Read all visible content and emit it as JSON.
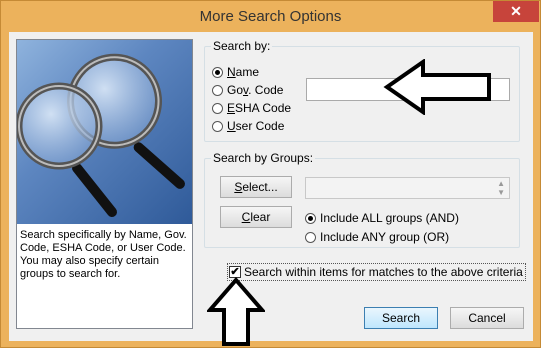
{
  "window": {
    "title": "More Search Options",
    "close": "✕"
  },
  "side": {
    "description": "Search specifically by Name, Gov. Code, ESHA Code, or User Code. You may also specify certain groups to search for."
  },
  "search_by": {
    "legend": "Search by:",
    "options": [
      {
        "pre": "",
        "ul": "N",
        "post": "ame",
        "checked": true
      },
      {
        "pre": "Go",
        "ul": "v",
        "post": ". Code",
        "checked": false
      },
      {
        "pre": "",
        "ul": "E",
        "post": "SHA Code",
        "checked": false
      },
      {
        "pre": "",
        "ul": "U",
        "post": "ser Code",
        "checked": false
      }
    ],
    "query_value": ""
  },
  "groups": {
    "legend": "Search by Groups:",
    "select_button": {
      "ul": "S",
      "post": "elect..."
    },
    "clear_button": {
      "pre": "",
      "ul": "C",
      "post": "lear"
    },
    "selected_value": "",
    "include_all": "Include ALL groups (AND)",
    "include_any": "Include ANY group (OR)",
    "include_all_checked": true
  },
  "within_items": {
    "label": "Search within items for matches to the above criteria",
    "checked": true,
    "mark": "✔"
  },
  "buttons": {
    "search": "Search",
    "cancel": "Cancel"
  }
}
